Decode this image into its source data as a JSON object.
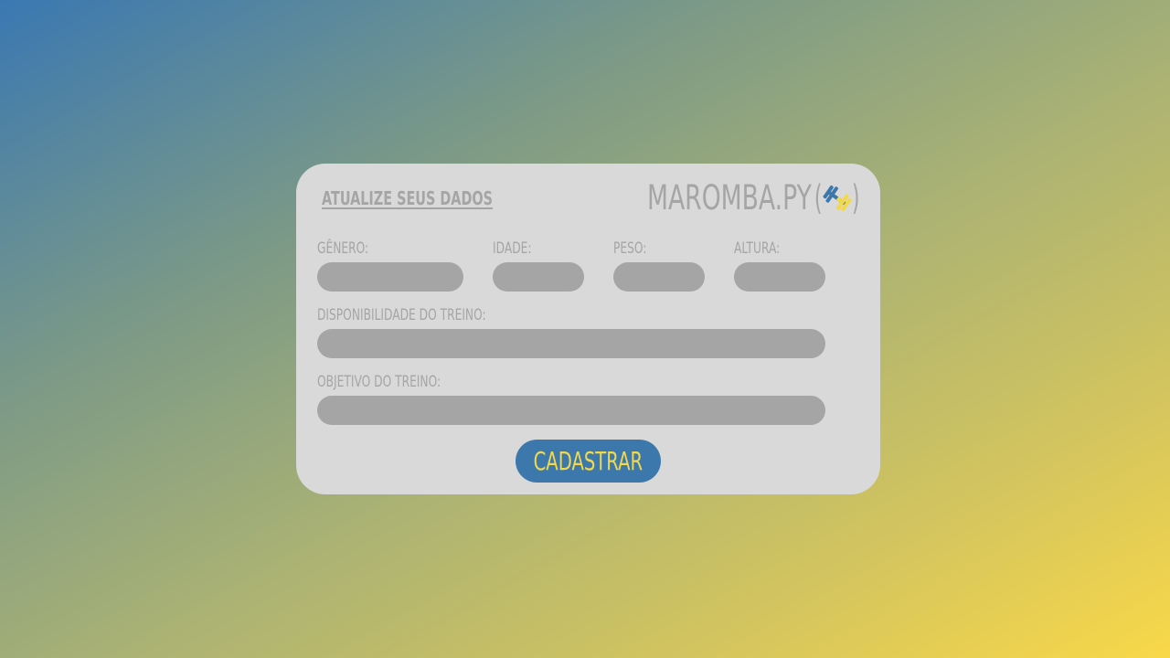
{
  "colors": {
    "card_background": "#d9d9d9",
    "text_muted": "#a5a5a5",
    "field_fill": "#a5a5a5",
    "button_fill": "#3c78ac",
    "button_text": "#f3d94a",
    "gradient_start": "#3a78b2",
    "gradient_end": "#f9d848"
  },
  "form": {
    "title": "ATUALIZE SEUS DADOS",
    "brand": {
      "name": "MAROMBA.PY",
      "open_paren": "(",
      "close_paren": ")",
      "icon": "dumbbell-icon"
    },
    "fields": {
      "genero": {
        "label": "GÊNERO:",
        "value": ""
      },
      "idade": {
        "label": "IDADE:",
        "value": ""
      },
      "peso": {
        "label": "PESO:",
        "value": ""
      },
      "altura": {
        "label": "ALTURA:",
        "value": ""
      },
      "disponibilidade": {
        "label": "DISPONIBILIDADE DO TREINO:",
        "value": ""
      },
      "objetivo": {
        "label": "OBJETIVO DO TREINO:",
        "value": ""
      }
    },
    "submit_label": "CADASTRAR"
  }
}
